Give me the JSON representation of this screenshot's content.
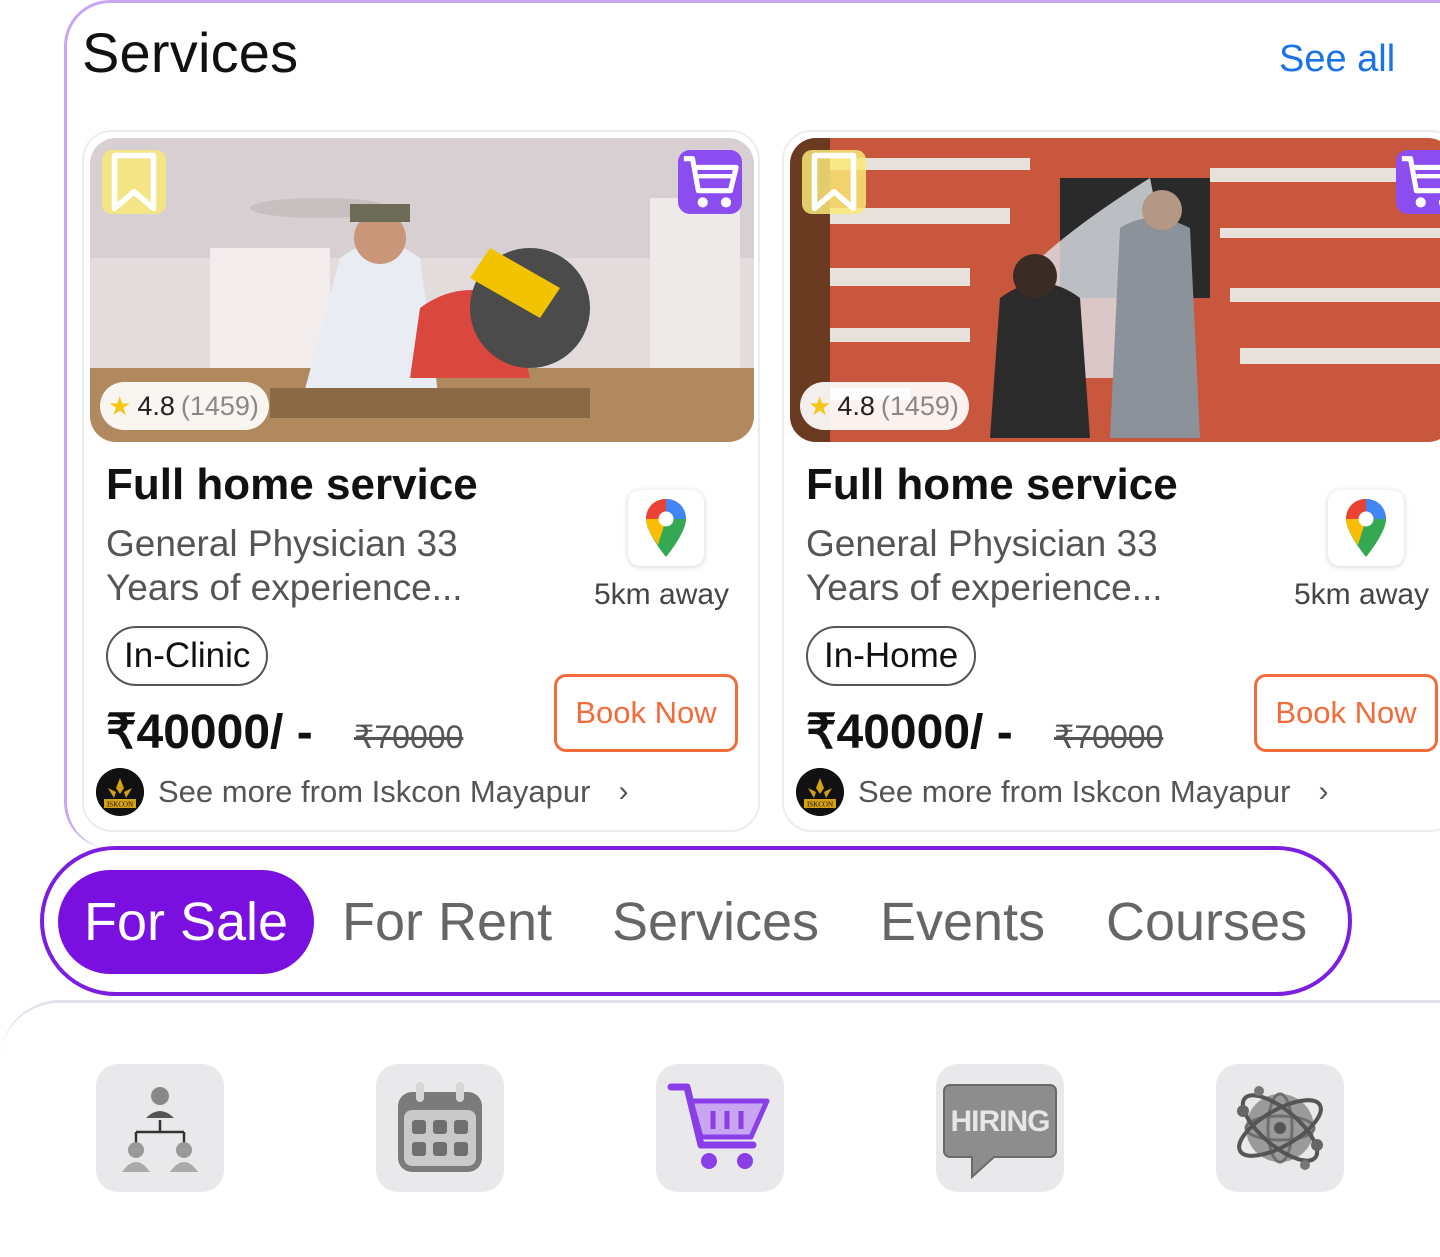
{
  "section": {
    "title": "Services",
    "see_all": "See all"
  },
  "cards": [
    {
      "rating": "4.8",
      "rating_count": "(1459)",
      "title": "Full home service",
      "description": "General Physician 33 Years of experience...",
      "distance": "5km away",
      "tag": "In-Clinic",
      "price": "₹40000/ -",
      "old_price": "₹70000",
      "book_label": "Book Now",
      "seller_link": "See more from Iskcon Mayapur",
      "seller_logo_text": "ISKCON"
    },
    {
      "rating": "4.8",
      "rating_count": "(1459)",
      "title": "Full home service",
      "description": "General Physician 33 Years of experience...",
      "distance": "5km away",
      "tag": "In-Home",
      "price": "₹40000/ -",
      "old_price": "₹70000",
      "book_label": "Book Now",
      "seller_link": "See more from Iskcon Mayapur",
      "seller_logo_text": "ISKCON"
    }
  ],
  "tabs": [
    {
      "label": "For Sale",
      "active": true
    },
    {
      "label": "For Rent",
      "active": false
    },
    {
      "label": "Services",
      "active": false
    },
    {
      "label": "Events",
      "active": false
    },
    {
      "label": "Courses",
      "active": false
    }
  ],
  "categories": [
    {
      "icon": "org-chart-icon"
    },
    {
      "icon": "calendar-icon"
    },
    {
      "icon": "shopping-cart-icon",
      "text": ""
    },
    {
      "icon": "hiring-icon",
      "text": "HIRING"
    },
    {
      "icon": "globe-network-icon"
    }
  ],
  "colors": {
    "accent_purple": "#7a10e0",
    "link_blue": "#1a73e8",
    "book_orange": "#f26b3a",
    "frame_lavender": "#c9a6f2"
  }
}
